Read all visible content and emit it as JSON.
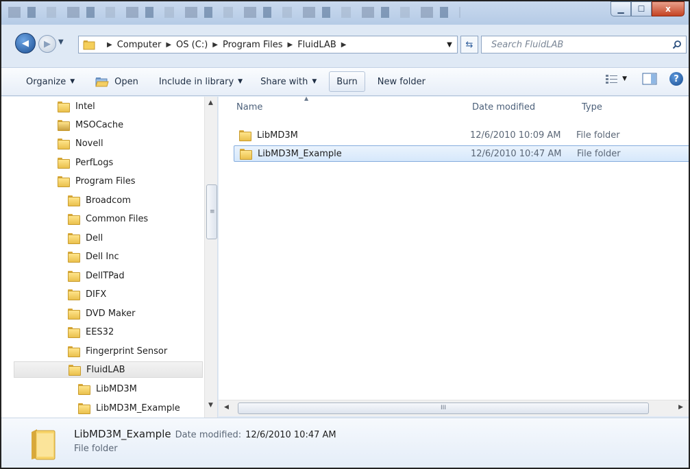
{
  "window": {
    "min_label": "▁",
    "max_label": "☐",
    "close_label": "x"
  },
  "address": {
    "crumbs": [
      "Computer",
      "OS (C:)",
      "Program Files",
      "FluidLAB"
    ],
    "search_placeholder": "Search FluidLAB"
  },
  "toolbar": {
    "organize": "Organize",
    "open": "Open",
    "include_in_library": "Include in library",
    "share_with": "Share with",
    "burn": "Burn",
    "new_folder": "New folder"
  },
  "nav": {
    "items": [
      {
        "label": "Intel",
        "level": 0
      },
      {
        "label": "MSOCache",
        "level": 0
      },
      {
        "label": "Novell",
        "level": 0
      },
      {
        "label": "PerfLogs",
        "level": 0
      },
      {
        "label": "Program Files",
        "level": 0
      },
      {
        "label": "Broadcom",
        "level": 1
      },
      {
        "label": "Common Files",
        "level": 1
      },
      {
        "label": "Dell",
        "level": 1
      },
      {
        "label": "Dell Inc",
        "level": 1
      },
      {
        "label": "DellTPad",
        "level": 1
      },
      {
        "label": "DIFX",
        "level": 1
      },
      {
        "label": "DVD Maker",
        "level": 1
      },
      {
        "label": "EES32",
        "level": 1
      },
      {
        "label": "Fingerprint Sensor",
        "level": 1
      },
      {
        "label": "FluidLAB",
        "level": 1,
        "selected": true
      },
      {
        "label": "LibMD3M",
        "level": 2
      },
      {
        "label": "LibMD3M_Example",
        "level": 2
      }
    ]
  },
  "columns": {
    "name": "Name",
    "date_modified": "Date modified",
    "type": "Type"
  },
  "files": [
    {
      "name": "LibMD3M",
      "date": "12/6/2010 10:09 AM",
      "type": "File folder"
    },
    {
      "name": "LibMD3M_Example",
      "date": "12/6/2010 10:47 AM",
      "type": "File folder",
      "selected": true
    }
  ],
  "details": {
    "name": "LibMD3M_Example",
    "date_label": "Date modified:",
    "date": "12/6/2010 10:47 AM",
    "type": "File folder"
  },
  "scroll": {
    "grip": "≡",
    "hgrip": "III"
  }
}
